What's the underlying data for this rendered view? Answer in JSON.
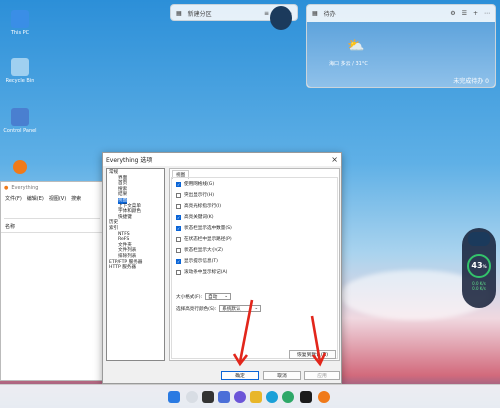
{
  "desktop": {
    "icons": [
      {
        "label": "This PC",
        "icon": "computer-icon",
        "color": "#3a8ee6"
      },
      {
        "label": "Recycle Bin",
        "icon": "recycle-bin-icon",
        "color": "#9fd0f0"
      },
      {
        "label": "Control Panel",
        "icon": "control-panel-icon",
        "color": "#4a7fd0"
      },
      {
        "label": "",
        "icon": "everything-app-icon",
        "color": "#f07a1a"
      }
    ]
  },
  "widget_left": {
    "add_label": "新建分区"
  },
  "widget_right": {
    "title": "待办",
    "weather_location": "海口 多云 / 31°C",
    "todo_status": "未完成待办 0"
  },
  "bg_window": {
    "title": "Everything",
    "menus": [
      "文件(F)",
      "编辑(E)",
      "视图(V)",
      "搜索"
    ],
    "column_header": "名称"
  },
  "dialog": {
    "title": "Everything 选项",
    "close": "×",
    "tree": [
      {
        "label": "常规",
        "level": 0
      },
      {
        "label": "界面",
        "level": 1
      },
      {
        "label": "首页",
        "level": 1
      },
      {
        "label": "搜索",
        "level": 1
      },
      {
        "label": "结果",
        "level": 1
      },
      {
        "label": "视图",
        "level": 1,
        "selected": true
      },
      {
        "label": "上下文菜单",
        "level": 1
      },
      {
        "label": "字体和颜色",
        "level": 1
      },
      {
        "label": "快捷键",
        "level": 1
      },
      {
        "label": "历史",
        "level": 0
      },
      {
        "label": "索引",
        "level": 0
      },
      {
        "label": "NTFS",
        "level": 1
      },
      {
        "label": "ReFS",
        "level": 1
      },
      {
        "label": "文件夹",
        "level": 1
      },
      {
        "label": "文件列表",
        "level": 1
      },
      {
        "label": "排除列表",
        "level": 1
      },
      {
        "label": "ETP/FTP 服务器",
        "level": 0
      },
      {
        "label": "HTTP 服务器",
        "level": 0
      }
    ],
    "section": "视图",
    "checkboxes": [
      {
        "label": "使用网格线(G)",
        "checked": true
      },
      {
        "label": "突出显示行(H)",
        "checked": false
      },
      {
        "label": "高亮光标指示行(I)",
        "checked": false
      },
      {
        "label": "高亮关键词(K)",
        "checked": true
      },
      {
        "label": "状态栏显示选中数量(S)",
        "checked": true
      },
      {
        "label": "在状态栏中显示路径(P)",
        "checked": false
      },
      {
        "label": "状态栏显示大小(Z)",
        "checked": false
      },
      {
        "label": "显示提示信息(T)",
        "checked": true
      },
      {
        "label": "滚动条中显示标记(A)",
        "checked": false
      }
    ],
    "size_format_label": "大小格式(F):",
    "size_format_value": "自动",
    "selection_label": "选择高亮行颜色(S):",
    "selection_value": "系统默认",
    "restore_defaults": "恢复到默认(R)",
    "ok": "确定",
    "cancel": "取消",
    "apply": "应用"
  },
  "side_widget": {
    "cpu": "43",
    "unit": "%",
    "net_up": "0.0 K/s",
    "net_down": "0.0 K/s"
  },
  "colors": {
    "accent": "#0a64d6",
    "arrow": "#e2261b"
  }
}
